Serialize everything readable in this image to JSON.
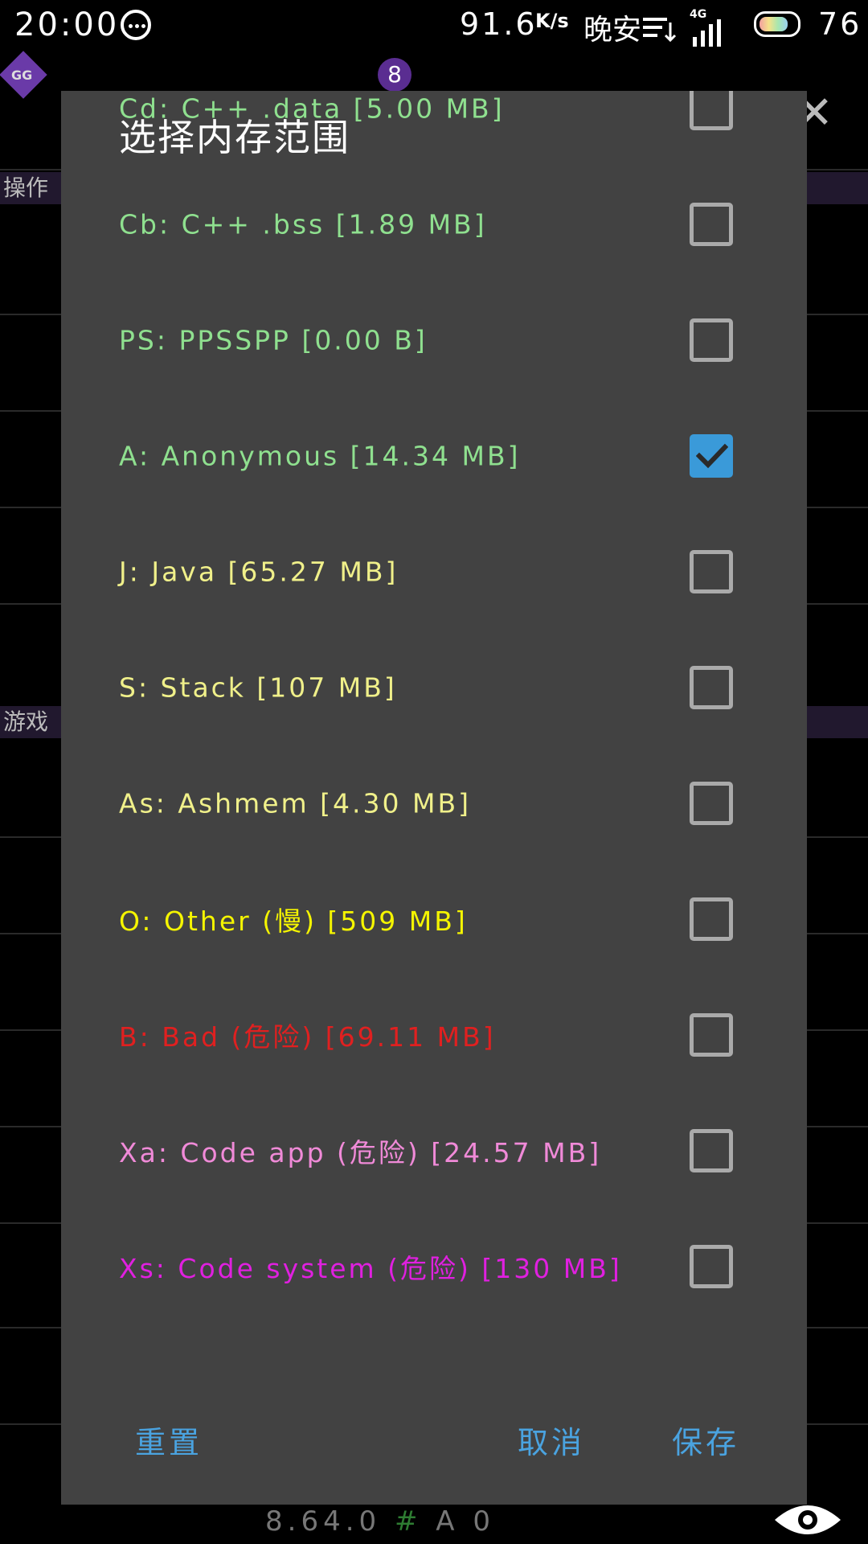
{
  "status_bar": {
    "time": "20:00",
    "speed": "91.6",
    "speed_unit": "K/s",
    "night_label": "晚安",
    "network": "4G",
    "battery": "76",
    "battery_level_percent": 76
  },
  "background_app": {
    "badge": "8",
    "logo_text": "GG",
    "section_1": "操作",
    "section_2": "游戏",
    "version_prefix": "8.64.0",
    "version_hash": "#",
    "version_suffix": "A 0"
  },
  "dialog": {
    "title": "选择内存范围",
    "clipped_item": {
      "label": "Cd: C++ .data [5.00 MB]",
      "color": "#8fe08f",
      "checked": false
    },
    "items": [
      {
        "label": "Cb: C++ .bss [1.89 MB]",
        "color": "#8fe08f",
        "checked": false
      },
      {
        "label": "PS: PPSSPP [0.00 B]",
        "color": "#8fe08f",
        "checked": false
      },
      {
        "label": "A: Anonymous [14.34 MB]",
        "color": "#8fe08f",
        "checked": true
      },
      {
        "label": "J: Java [65.27 MB]",
        "color": "#f0f08a",
        "checked": false
      },
      {
        "label": "S: Stack [107 MB]",
        "color": "#f0f08a",
        "checked": false
      },
      {
        "label": "As: Ashmem [4.30 MB]",
        "color": "#f0f08a",
        "checked": false
      },
      {
        "label": "O: Other (慢) [509 MB]",
        "color": "#f5f500",
        "checked": false
      },
      {
        "label": "B: Bad (危险) [69.11 MB]",
        "color": "#e02020",
        "checked": false
      },
      {
        "label": "Xa: Code app (危险) [24.57 MB]",
        "color": "#f08ad8",
        "checked": false
      },
      {
        "label": "Xs: Code system (危险) [130 MB]",
        "color": "#e020e0",
        "checked": false
      }
    ],
    "buttons": {
      "reset": "重置",
      "cancel": "取消",
      "save": "保存"
    },
    "accent_color": "#4aa3e0"
  }
}
